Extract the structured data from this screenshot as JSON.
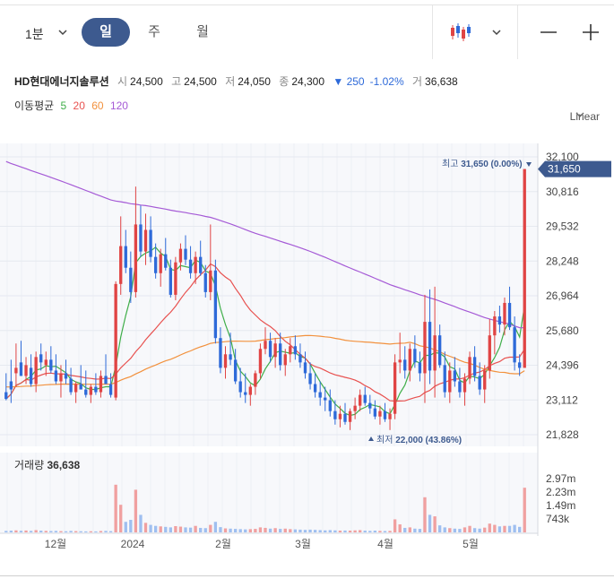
{
  "toolbar": {
    "interval": "1분",
    "tabs": [
      "일",
      "주",
      "월"
    ],
    "active_tab": "일",
    "chart_type_icon": "candlestick-icon",
    "buttons": [
      "minus-icon",
      "plus-icon"
    ]
  },
  "stock": {
    "name": "HD현대에너지솔루션",
    "open_label": "시",
    "open": "24,500",
    "high_label": "고",
    "high": "24,500",
    "low_label": "저",
    "low": "24,050",
    "close_label": "종",
    "close": "24,300",
    "change": "▼ 250",
    "change_pct": "-1.02%",
    "volume_label": "거",
    "volume": "36,638"
  },
  "ma": {
    "label": "이동평균",
    "periods": [
      "5",
      "20",
      "60",
      "120"
    ],
    "colors": [
      "#3fae49",
      "#e8514f",
      "#f2913d",
      "#a55ad6"
    ]
  },
  "scale_mode": "Linear",
  "colors": {
    "up": "#e04444",
    "down": "#2e6ad9",
    "accent": "#3d5a8f",
    "volume_up": "#f0a0a0",
    "volume_down": "#9fbff0"
  },
  "chart_data": {
    "type": "candlestick",
    "y_axis_ticks": [
      "32,100",
      "30,816",
      "29,532",
      "28,248",
      "26,964",
      "25,680",
      "24,396",
      "23,112",
      "21,828"
    ],
    "ylim": [
      21828,
      32100
    ],
    "x_axis_labels": [
      "12월",
      "2024",
      "2월",
      "3월",
      "4월",
      "5월"
    ],
    "last_price_label": "31,650",
    "high_marker": {
      "label": "최고",
      "value": "31,650",
      "pct": "(0.00%)"
    },
    "low_marker": {
      "label": "최저",
      "value": "22,000",
      "pct": "(43.86%)"
    },
    "volume_label": "거래량",
    "volume_value": "36,638",
    "volume_ticks": [
      "2.97m",
      "2.23m",
      "1.49m",
      "743k"
    ],
    "candles": [
      [
        23400,
        24100,
        23100,
        23150
      ],
      [
        23800,
        24600,
        23000,
        23500
      ],
      [
        24100,
        25200,
        23600,
        24300
      ],
      [
        24500,
        25300,
        24000,
        24000
      ],
      [
        24000,
        24700,
        23700,
        24400
      ],
      [
        24300,
        24800,
        23600,
        23700
      ],
      [
        23700,
        24900,
        23400,
        24700
      ],
      [
        24800,
        25200,
        24200,
        24500
      ],
      [
        24400,
        24900,
        24000,
        24600
      ],
      [
        24600,
        25100,
        24100,
        24200
      ],
      [
        24200,
        24800,
        23700,
        23800
      ],
      [
        23800,
        24400,
        23200,
        24100
      ],
      [
        24100,
        24600,
        23700,
        23900
      ],
      [
        23900,
        24300,
        23300,
        23400
      ],
      [
        23400,
        23800,
        23000,
        23700
      ],
      [
        23700,
        24400,
        23500,
        23500
      ],
      [
        23500,
        24200,
        23200,
        23300
      ],
      [
        23300,
        23700,
        23000,
        23600
      ],
      [
        23600,
        24100,
        23300,
        23400
      ],
      [
        23400,
        24200,
        23200,
        24000
      ],
      [
        24000,
        24800,
        23700,
        23700
      ],
      [
        23700,
        24100,
        23200,
        23300
      ],
      [
        23200,
        27500,
        23100,
        27400
      ],
      [
        27400,
        29900,
        27000,
        28800
      ],
      [
        28800,
        29400,
        27800,
        28000
      ],
      [
        28000,
        28600,
        26700,
        27100
      ],
      [
        27100,
        31000,
        26900,
        29600
      ],
      [
        29600,
        30300,
        28400,
        28600
      ],
      [
        28600,
        30000,
        28100,
        29400
      ],
      [
        29400,
        29900,
        28200,
        28400
      ],
      [
        28400,
        28900,
        27600,
        27800
      ],
      [
        27800,
        28700,
        27300,
        28500
      ],
      [
        28500,
        29100,
        27900,
        28000
      ],
      [
        28000,
        28300,
        26900,
        27000
      ],
      [
        27000,
        28400,
        26800,
        28200
      ],
      [
        28200,
        28900,
        27900,
        28700
      ],
      [
        28700,
        29200,
        28100,
        28300
      ],
      [
        28300,
        28800,
        27600,
        27800
      ],
      [
        27800,
        28600,
        27400,
        28400
      ],
      [
        28400,
        29000,
        27700,
        27800
      ],
      [
        27800,
        28100,
        26900,
        27100
      ],
      [
        27100,
        29600,
        26800,
        27900
      ],
      [
        27900,
        28300,
        25200,
        25400
      ],
      [
        25400,
        25800,
        24100,
        24300
      ],
      [
        24300,
        25100,
        23900,
        24800
      ],
      [
        24800,
        25600,
        24400,
        24600
      ],
      [
        24600,
        25000,
        23700,
        23800
      ],
      [
        23800,
        24300,
        23200,
        23400
      ],
      [
        23400,
        24100,
        23000,
        23300
      ],
      [
        23300,
        23700,
        22900,
        23600
      ],
      [
        23600,
        24200,
        23300,
        24100
      ],
      [
        24100,
        25200,
        23900,
        25000
      ],
      [
        25000,
        25800,
        24800,
        25300
      ],
      [
        25300,
        25600,
        24500,
        24700
      ],
      [
        24700,
        25400,
        24300,
        25200
      ],
      [
        25200,
        25600,
        24200,
        24400
      ],
      [
        24400,
        25000,
        24000,
        24800
      ],
      [
        24800,
        25400,
        24500,
        25100
      ],
      [
        25100,
        25500,
        24600,
        24800
      ],
      [
        24800,
        25200,
        24300,
        24500
      ],
      [
        24500,
        24900,
        23900,
        24100
      ],
      [
        24100,
        24500,
        23500,
        23700
      ],
      [
        23700,
        24100,
        23200,
        23400
      ],
      [
        23400,
        23800,
        22900,
        23200
      ],
      [
        23200,
        23600,
        22700,
        23100
      ],
      [
        23100,
        23500,
        22500,
        22700
      ],
      [
        22700,
        23100,
        22200,
        22400
      ],
      [
        22400,
        22900,
        22100,
        22600
      ],
      [
        22600,
        23000,
        22200,
        22300
      ],
      [
        22300,
        22800,
        22000,
        22700
      ],
      [
        22700,
        23200,
        22400,
        22900
      ],
      [
        22900,
        23500,
        22700,
        23300
      ],
      [
        23300,
        23600,
        22900,
        23000
      ],
      [
        23000,
        23300,
        22600,
        22800
      ],
      [
        22800,
        23100,
        22400,
        22500
      ],
      [
        22500,
        22900,
        22200,
        22700
      ],
      [
        22700,
        23000,
        22300,
        22400
      ],
      [
        22400,
        22800,
        22000,
        22600
      ],
      [
        22600,
        24800,
        22400,
        24500
      ],
      [
        24500,
        25600,
        24100,
        24600
      ],
      [
        24600,
        25100,
        23900,
        24200
      ],
      [
        24200,
        25200,
        23800,
        25000
      ],
      [
        25000,
        25500,
        24300,
        24500
      ],
      [
        24500,
        24900,
        23800,
        24100
      ],
      [
        24100,
        27000,
        23000,
        26000
      ],
      [
        26000,
        27200,
        23700,
        24200
      ],
      [
        24200,
        27300,
        23200,
        25500
      ],
      [
        25500,
        25900,
        24300,
        24400
      ],
      [
        24400,
        24900,
        23200,
        23400
      ],
      [
        23400,
        24500,
        23000,
        24200
      ],
      [
        24200,
        24700,
        23600,
        23800
      ],
      [
        23800,
        24300,
        23200,
        23400
      ],
      [
        23400,
        24100,
        22900,
        23900
      ],
      [
        23900,
        24900,
        23700,
        24700
      ],
      [
        24700,
        25100,
        23800,
        24000
      ],
      [
        24000,
        24500,
        23300,
        23500
      ],
      [
        23500,
        24400,
        23000,
        24200
      ],
      [
        24200,
        26100,
        23900,
        25500
      ],
      [
        25500,
        26400,
        24800,
        26200
      ],
      [
        26200,
        26600,
        25600,
        25900
      ],
      [
        25900,
        26900,
        25500,
        26700
      ],
      [
        26700,
        27300,
        25700,
        25800
      ],
      [
        25800,
        26200,
        24200,
        24500
      ],
      [
        24500,
        24800,
        24000,
        24300
      ],
      [
        24300,
        31650,
        24300,
        31650
      ]
    ],
    "volumes": [
      60,
      70,
      80,
      65,
      75,
      60,
      90,
      70,
      60,
      55,
      60,
      50,
      45,
      60,
      50,
      45,
      40,
      45,
      40,
      55,
      60,
      50,
      1900,
      1100,
      420,
      500,
      1700,
      700,
      380,
      300,
      260,
      240,
      220,
      200,
      250,
      230,
      200,
      190,
      260,
      180,
      170,
      300,
      420,
      210,
      160,
      150,
      140,
      130,
      120,
      130,
      140,
      200,
      180,
      150,
      170,
      140,
      150,
      130,
      120,
      110,
      100,
      110,
      100,
      90,
      80,
      90,
      80,
      70,
      75,
      70,
      80,
      90,
      70,
      60,
      70,
      60,
      55,
      60,
      520,
      320,
      180,
      200,
      150,
      140,
      1400,
      700,
      640,
      280,
      200,
      170,
      150,
      140,
      200,
      260,
      170,
      150,
      190,
      350,
      300,
      240,
      260,
      260,
      300,
      220,
      1780
    ]
  }
}
